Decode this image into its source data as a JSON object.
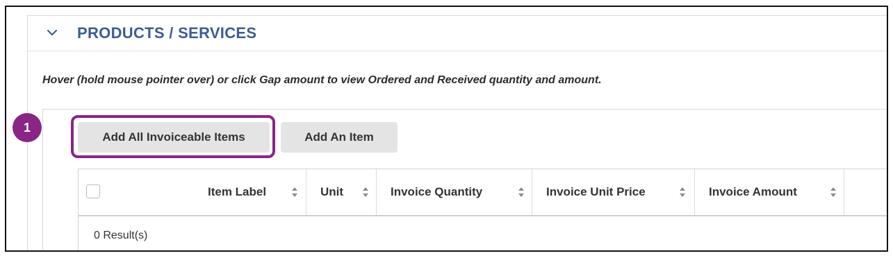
{
  "panel": {
    "title": "PRODUCTS / SERVICES",
    "hint": "Hover (hold mouse pointer over) or click Gap amount to view Ordered and Received quantity and amount."
  },
  "buttons": {
    "add_all": "Add All Invoiceable Items",
    "add_one": "Add An Item"
  },
  "callout": {
    "step": "1",
    "color": "#8a2587"
  },
  "table": {
    "columns": [
      "Item Label",
      "Unit",
      "Invoice Quantity",
      "Invoice Unit Price",
      "Invoice Amount"
    ],
    "footer": "0 Result(s)"
  },
  "colors": {
    "title": "#3d5d92",
    "button_bg": "#e4e4e4"
  },
  "icons": [
    "chevron-down-icon",
    "sort-icon",
    "checkbox-icon"
  ]
}
